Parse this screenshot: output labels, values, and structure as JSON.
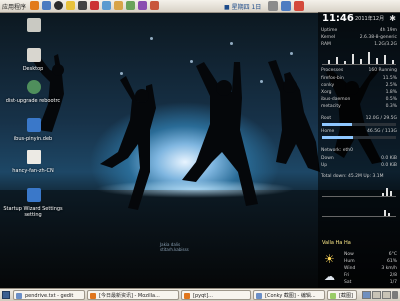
{
  "top_panel": {
    "menu_label": "应用程序",
    "clock_text": "■ 星期四 1日",
    "launchers": [
      "firefox-icon",
      "mail-icon",
      "qq-icon",
      "chat-icon",
      "terminal-icon",
      "music-icon",
      "calendar-icon",
      "folder-icon",
      "shield-icon",
      "player-icon",
      "map-icon"
    ]
  },
  "desktop_icons": [
    {
      "label": ""
    },
    {
      "label": "Desktop"
    },
    {
      "label": "dist-upgrade rebootrc"
    },
    {
      "label": "ibus-pinyin.deb"
    },
    {
      "label": "hancy-fan-zh-CN"
    },
    {
      "label": "Startup Wizard Settings setting"
    }
  ],
  "conky": {
    "time": "11:46",
    "date": "2011年12月",
    "watermark_line1": "Jakia dalis",
    "watermark_line2": "stitarh.kabisss",
    "rows_top": [
      {
        "k": "Uptime",
        "v": "4h 19m"
      },
      {
        "k": "Kernel",
        "v": "2.6.38-8-generic"
      },
      {
        "k": "RAM",
        "v": "1.2G/3.2G"
      }
    ],
    "cpu_label": "Processes",
    "cpu_value": "160 Running",
    "proc_rows": [
      {
        "k": "firefox-bin",
        "v": "11.5%"
      },
      {
        "k": "conky",
        "v": "2.5%"
      },
      {
        "k": "Xorg",
        "v": "1.8%"
      },
      {
        "k": "ibus-daemon",
        "v": "0.5%"
      },
      {
        "k": "metacity",
        "v": "0.3%"
      }
    ],
    "disk_rows": [
      {
        "k": "Root",
        "v": "12.0G / 29.5G"
      },
      {
        "k": "Home",
        "v": "46.5G / 113G"
      }
    ],
    "disk_fill": [
      0.41,
      0.42
    ],
    "net_label": "Network: eth0",
    "net_rows": [
      {
        "k": "Down",
        "v": "0.0 KiB"
      },
      {
        "k": "Up",
        "v": "0.0 KiB"
      }
    ],
    "totals": "Total down: 45.2M  Up: 3.1M",
    "weather_title": "Valla Ha Ha",
    "weather_rows": [
      {
        "k": "Now",
        "v": "6°C"
      },
      {
        "k": "Hum",
        "v": "61%"
      },
      {
        "k": "Wind",
        "v": "3 km/h"
      },
      {
        "k": "Fri",
        "v": "2/8"
      },
      {
        "k": "Sat",
        "v": "1/7"
      }
    ]
  },
  "taskbar": {
    "items": [
      {
        "label": "pendrive.txt - gedit",
        "icon_color": "#6b8fc7"
      },
      {
        "label": "[今日最新资讯] - Mozilla...",
        "icon_color": "#e0751c"
      },
      {
        "label": "[pyqt]...",
        "icon_color": "#e0751c"
      },
      {
        "label": "[Conky 截图] - 编辑...",
        "icon_color": "#6b8fc7"
      },
      {
        "label": "[截图]",
        "icon_color": "#9c6"
      }
    ]
  }
}
